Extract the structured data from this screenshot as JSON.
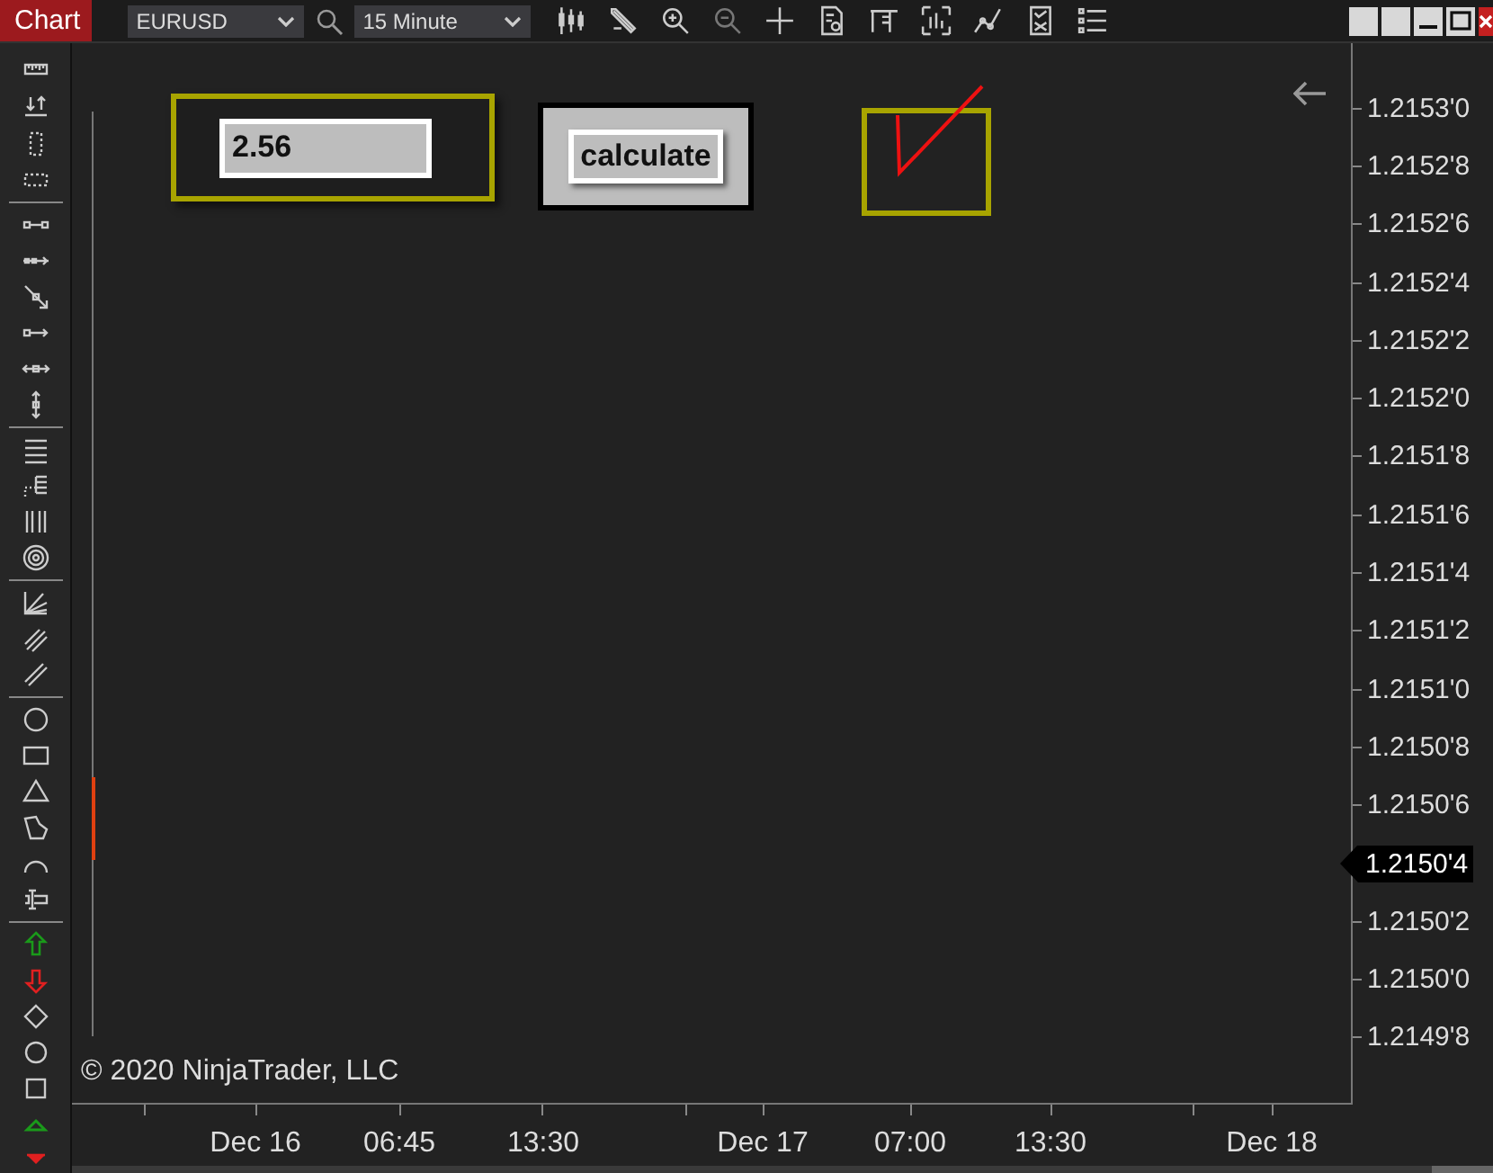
{
  "header": {
    "title": "Chart",
    "instrument": "EURUSD",
    "interval": "15 Minute"
  },
  "controls": {
    "input_value": "2.56",
    "button": "calculate",
    "checked": true
  },
  "price_axis": [
    {
      "label": "1.2153'0",
      "highlighted": false
    },
    {
      "label": "1.2152'8",
      "highlighted": false
    },
    {
      "label": "1.2152'6",
      "highlighted": false
    },
    {
      "label": "1.2152'4",
      "highlighted": false
    },
    {
      "label": "1.2152'2",
      "highlighted": false
    },
    {
      "label": "1.2152'0",
      "highlighted": false
    },
    {
      "label": "1.2151'8",
      "highlighted": false
    },
    {
      "label": "1.2151'6",
      "highlighted": false
    },
    {
      "label": "1.2151'4",
      "highlighted": false
    },
    {
      "label": "1.2151'2",
      "highlighted": false
    },
    {
      "label": "1.2151'0",
      "highlighted": false
    },
    {
      "label": "1.2150'8",
      "highlighted": false
    },
    {
      "label": "1.2150'6",
      "highlighted": false
    },
    {
      "label": "1.2150'4",
      "highlighted": true
    },
    {
      "label": "1.2150'2",
      "highlighted": false
    },
    {
      "label": "1.2150'0",
      "highlighted": false
    },
    {
      "label": "1.2149'8",
      "highlighted": false
    }
  ],
  "time_axis": [
    "Dec 16",
    "06:45",
    "13:30",
    "Dec 17",
    "07:00",
    "13:30",
    "Dec 18"
  ],
  "copyright": "© 2020 NinjaTrader, LLC"
}
